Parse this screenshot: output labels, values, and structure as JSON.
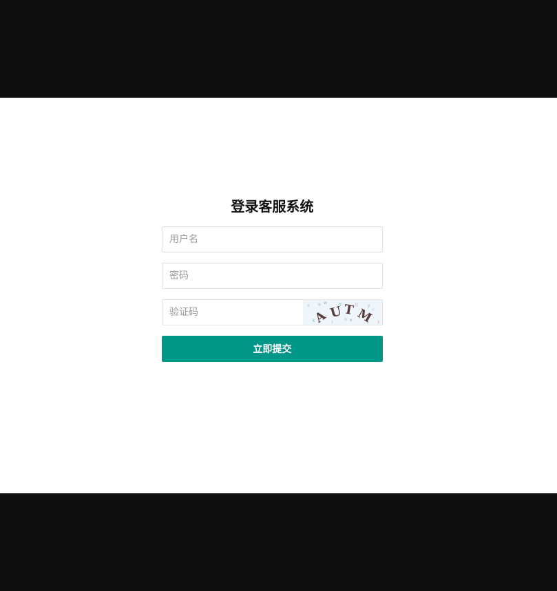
{
  "login": {
    "title": "登录客服系统",
    "username_placeholder": "用户名",
    "password_placeholder": "密码",
    "captcha_placeholder": "验证码",
    "captcha_text": "AUTM",
    "submit_label": "立即提交"
  },
  "colors": {
    "background_outer": "#0f0f0f",
    "panel": "#ffffff",
    "primary_button": "#009688",
    "field_border": "#e2e2e2",
    "captcha_text": "#5a3a3a"
  }
}
